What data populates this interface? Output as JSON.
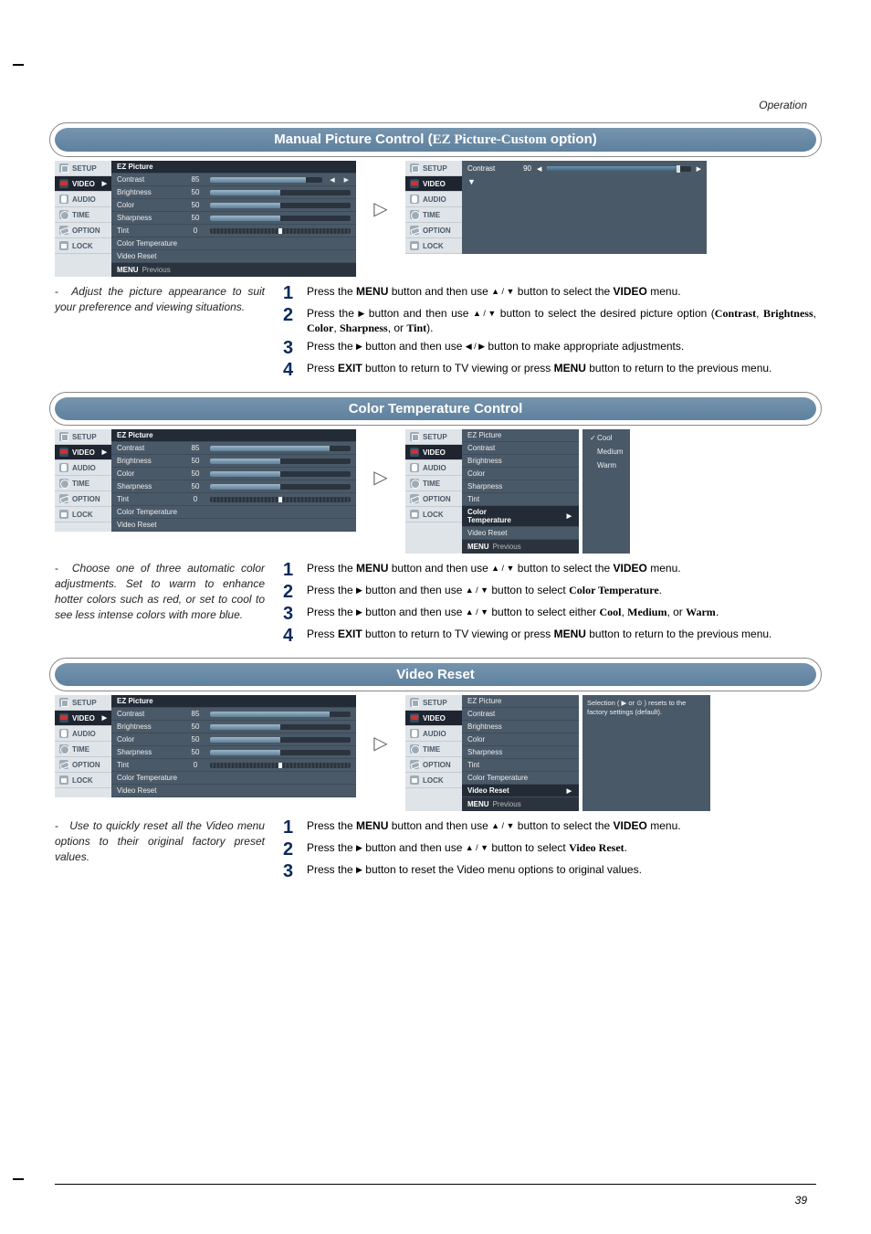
{
  "header": {
    "operation": "Operation",
    "page_number": "39"
  },
  "menus": {
    "items": [
      "SETUP",
      "VIDEO",
      "AUDIO",
      "TIME",
      "OPTION",
      "LOCK"
    ],
    "footer_menu": "MENU",
    "footer_prev": "Previous"
  },
  "video_panel": {
    "ez_picture": "EZ Picture",
    "contrast_label": "Contrast",
    "contrast_val": "85",
    "brightness_label": "Brightness",
    "brightness_val": "50",
    "color_label": "Color",
    "color_val": "50",
    "sharpness_label": "Sharpness",
    "sharpness_val": "50",
    "tint_label": "Tint",
    "tint_val": "0",
    "ct_label": "Color Temperature",
    "reset_label": "Video Reset"
  },
  "slider_single": {
    "label": "Contrast",
    "value": "90"
  },
  "ct_options": {
    "cool": "Cool",
    "medium": "Medium",
    "warm": "Warm"
  },
  "reset_note": "Selection ( ▶ or ⊙ ) resets to the factory settings (default).",
  "sections": {
    "s1": {
      "title_pre": "Manual Picture Control (",
      "title_ez": "EZ Picture-Custom",
      "title_post": " option)",
      "aside": "Adjust the picture appearance to suit your preference and viewing situations.",
      "step1a": "Press the ",
      "step1b": "MENU",
      "step1c": " button and then use ",
      "step1d": " button to select the ",
      "step1e": "VIDEO",
      "step1f": " menu.",
      "step2a": "Press the ",
      "step2b": " button and then use ",
      "step2c": " button to select the desired picture option (",
      "step2_o1": "Contrast",
      "step2_o2": "Brightness",
      "step2_o3": "Color",
      "step2_o4": "Sharpness",
      "step2_o5": "Tint",
      "step2d": ").",
      "step3a": "Press the ",
      "step3b": " button and then use ",
      "step3c": " button to make appropriate adjustments.",
      "step4a": "Press ",
      "step4b": "EXIT",
      "step4c": " button to return to TV viewing or press ",
      "step4d": "MENU",
      "step4e": " button to return to the previous menu."
    },
    "s2": {
      "title": "Color Temperature Control",
      "aside": "Choose one of three automatic color adjustments. Set to warm to enhance hotter colors such as red, or set to cool to see less intense colors with more blue.",
      "step1a": "Press the ",
      "step1b": "MENU",
      "step1c": " button and then use ",
      "step1d": " button to select the ",
      "step1e": "VIDEO",
      "step1f": " menu.",
      "step2a": "Press the ",
      "step2b": " button and then use ",
      "step2c": " button to select ",
      "step2d": "Color Temperature",
      "step2e": ".",
      "step3a": "Press the ",
      "step3b": " button and then use ",
      "step3c": " button to select either ",
      "step3d": "Cool",
      "step3e": "Medium",
      "step3f": "Warm",
      "step3g": ".",
      "step4a": "Press ",
      "step4b": "EXIT",
      "step4c": " button to return to TV viewing or press ",
      "step4d": "MENU",
      "step4e": " button to return to the previous menu."
    },
    "s3": {
      "title": "Video Reset",
      "aside": "Use to quickly reset all the Video menu options to their original factory preset values.",
      "step1a": "Press the ",
      "step1b": "MENU",
      "step1c": " button and then use ",
      "step1d": " button to select the ",
      "step1e": "VIDEO",
      "step1f": " menu.",
      "step2a": "Press the ",
      "step2b": " button and then use ",
      "step2c": " button to select ",
      "step2d": "Video Reset",
      "step2e": ".",
      "step3a": "Press the ",
      "step3b": " button to reset the Video menu options to original values."
    }
  }
}
